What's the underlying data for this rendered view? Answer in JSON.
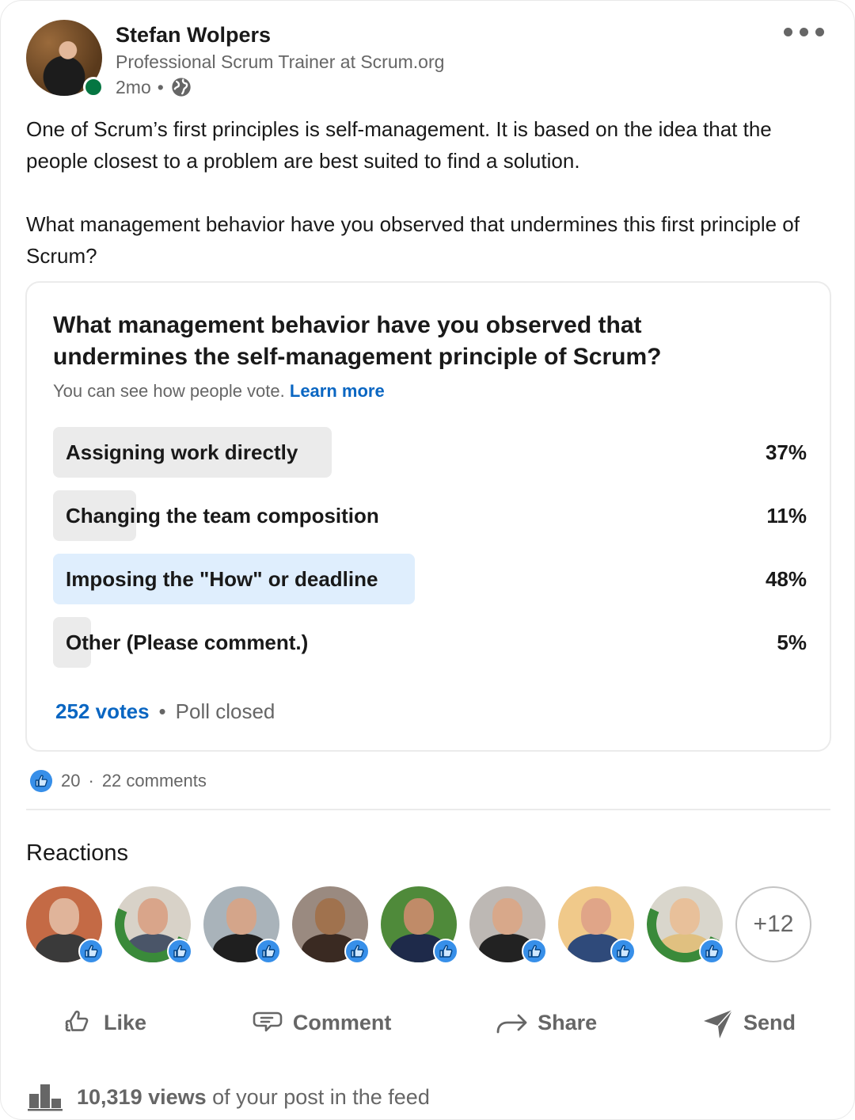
{
  "post": {
    "author": {
      "name": "Stefan Wolpers",
      "headline": "Professional Scrum Trainer at Scrum.org",
      "time": "2mo",
      "separator": "•",
      "visibility_icon": "globe-icon",
      "online": true
    },
    "menu_icon": "more-horizontal-icon",
    "text": {
      "paragraph1": "One of Scrum’s first principles is self-management. It is based on the idea that the people closest to a problem are best suited to find a solution.",
      "paragraph2": "What management behavior have you observed that undermines this first principle of Scrum?"
    }
  },
  "poll": {
    "question": "What management behavior have you observed that undermines the self-management principle of Scrum?",
    "subtitle": "You can see how people vote.",
    "learn_more": "Learn more",
    "options": [
      {
        "label": "Assigning work directly",
        "percent_label": "37%",
        "percent": 37,
        "leading": false
      },
      {
        "label": "Changing the team composition",
        "percent_label": "11%",
        "percent": 11,
        "leading": false
      },
      {
        "label": "Imposing the \"How\" or deadline",
        "percent_label": "48%",
        "percent": 48,
        "leading": true
      },
      {
        "label": "Other (Please comment.)",
        "percent_label": "5%",
        "percent": 5,
        "leading": false
      }
    ],
    "votes": "252 votes",
    "separator": "•",
    "status": "Poll closed"
  },
  "social": {
    "reaction_icon": "like-reaction-icon",
    "reaction_count": "20",
    "separator": "·",
    "comments": "22 comments"
  },
  "reactions": {
    "title": "Reactions",
    "people": [
      {
        "bg": "#c46a45",
        "face": "#e0b49a",
        "body": "#3a3a3a",
        "open_to_work": false
      },
      {
        "bg": "#d8d2c8",
        "face": "#d9a58a",
        "body": "#4a5568",
        "open_to_work": true
      },
      {
        "bg": "#a9b3ba",
        "face": "#d4a58a",
        "body": "#1f1f1f",
        "open_to_work": false
      },
      {
        "bg": "#9a8a80",
        "face": "#a0724e",
        "body": "#3a2a22",
        "open_to_work": false
      },
      {
        "bg": "#4f8a3a",
        "face": "#c08b68",
        "body": "#1e2a4a",
        "open_to_work": false
      },
      {
        "bg": "#bdb8b4",
        "face": "#d8a88a",
        "body": "#222222",
        "open_to_work": false
      },
      {
        "bg": "#f0c98a",
        "face": "#e0a588",
        "body": "#2f4a7a",
        "open_to_work": false
      },
      {
        "bg": "#d9d6cc",
        "face": "#e8c09a",
        "body": "#e0c080",
        "open_to_work": true
      }
    ],
    "more": "+12"
  },
  "actions": [
    {
      "label": "Like",
      "icon": "thumbs-up-icon"
    },
    {
      "label": "Comment",
      "icon": "comment-icon"
    },
    {
      "label": "Share",
      "icon": "share-arrow-icon"
    },
    {
      "label": "Send",
      "icon": "send-icon"
    }
  ],
  "views": {
    "count": "10,319 views",
    "suffix": "of your post in the feed",
    "icon": "bar-chart-icon"
  },
  "colors": {
    "accent": "#0a66c2",
    "online": "#057642",
    "leading_bar": "#dfeefd",
    "bar": "#ebebeb",
    "muted_text": "#666666"
  }
}
